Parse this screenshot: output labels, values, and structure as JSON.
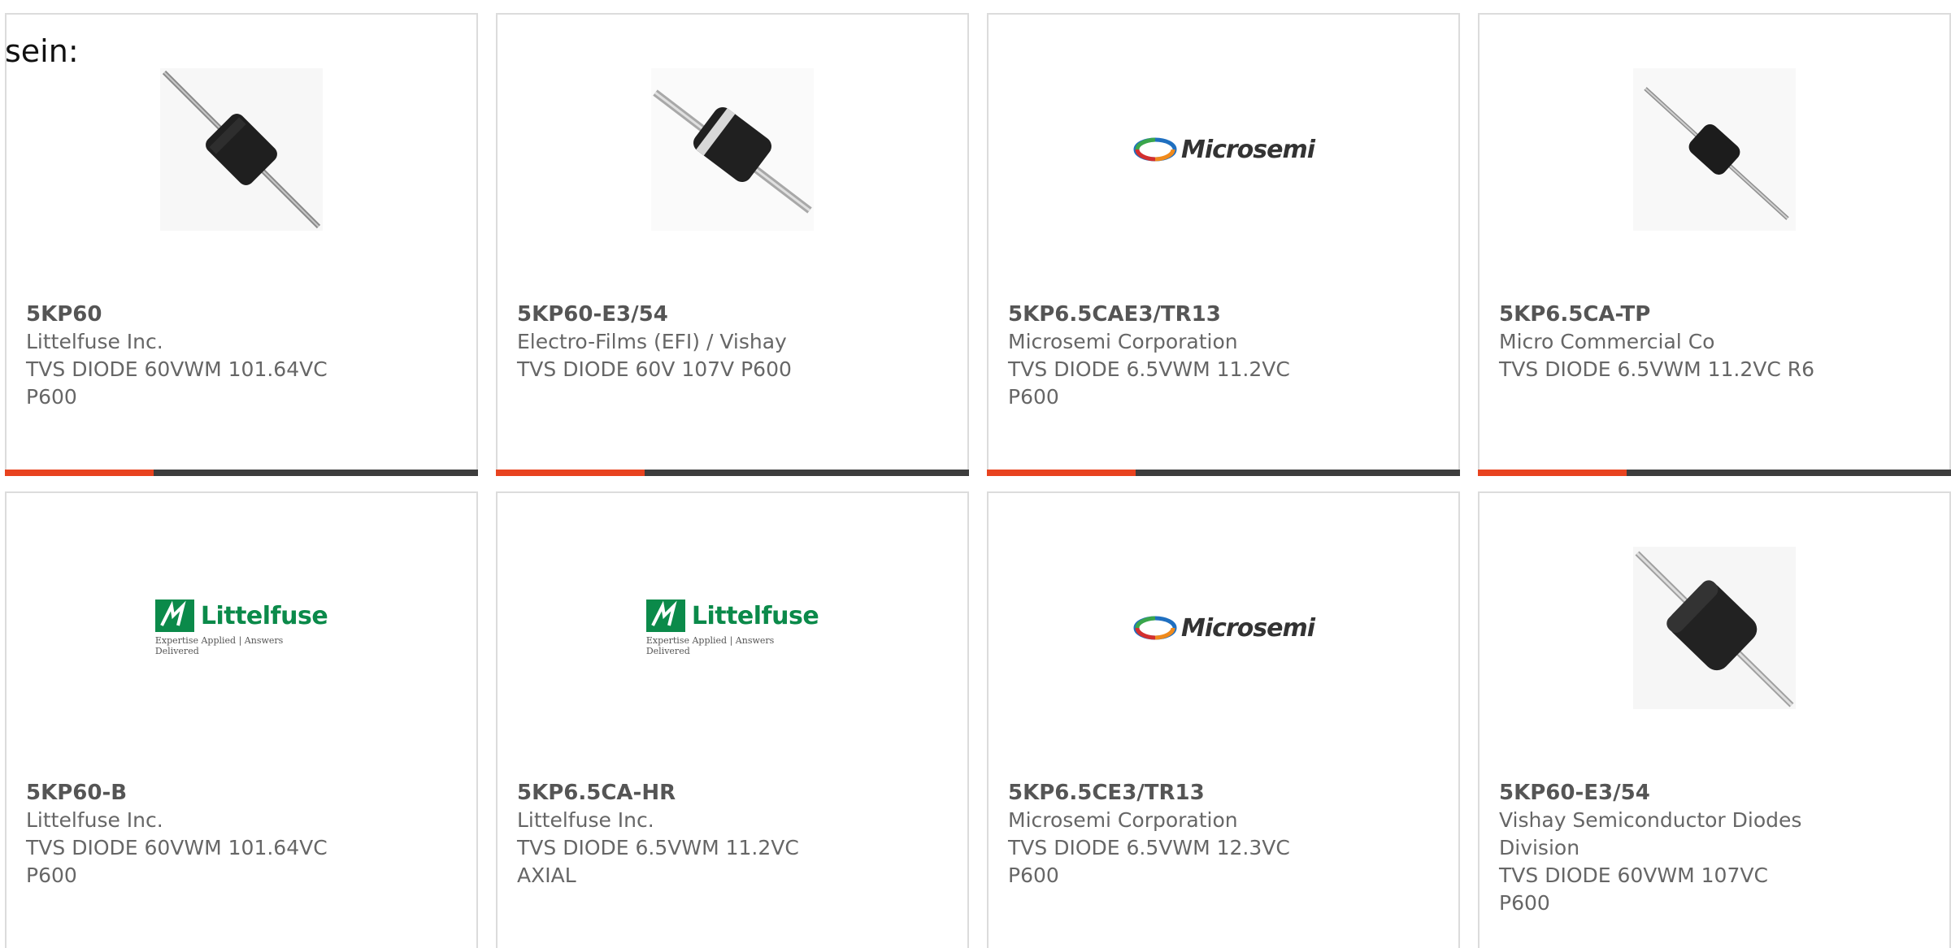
{
  "heading": "sein:",
  "brand_colors": {
    "accent": "#e8431f",
    "bar": "#3d3d3d",
    "littelfuse_green": "#0b8a4a"
  },
  "products": [
    {
      "part": "5KP60",
      "manufacturer": "Littelfuse Inc.",
      "description": "TVS DIODE 60VWM 101.64VC P600",
      "image": "diode-photo-icon",
      "image_alt": "diode photo"
    },
    {
      "part": "5KP60-E3/54",
      "manufacturer": "Electro-Films (EFI) / Vishay",
      "description": "TVS DIODE 60V 107V P600",
      "image": "diode-photo-icon",
      "image_alt": "diode photo"
    },
    {
      "part": "5KP6.5CAE3/TR13",
      "manufacturer": "Microsemi Corporation",
      "description": "TVS DIODE 6.5VWM 11.2VC P600",
      "image": "microsemi-logo",
      "logo_text": "Microsemi"
    },
    {
      "part": "5KP6.5CA-TP",
      "manufacturer": "Micro Commercial Co",
      "description": "TVS DIODE 6.5VWM 11.2VC R6",
      "image": "diode-photo-icon",
      "image_alt": "diode photo"
    },
    {
      "part": "5KP60-B",
      "manufacturer": "Littelfuse Inc.",
      "description": "TVS DIODE 60VWM 101.64VC P600",
      "image": "littelfuse-logo",
      "logo_text": "Littelfuse",
      "logo_tagline": "Expertise Applied | Answers Delivered"
    },
    {
      "part": "5KP6.5CA-HR",
      "manufacturer": "Littelfuse Inc.",
      "description": "TVS DIODE 6.5VWM 11.2VC AXIAL",
      "image": "littelfuse-logo",
      "logo_text": "Littelfuse",
      "logo_tagline": "Expertise Applied | Answers Delivered"
    },
    {
      "part": "5KP6.5CE3/TR13",
      "manufacturer": "Microsemi Corporation",
      "description": "TVS DIODE 6.5VWM 12.3VC P600",
      "image": "microsemi-logo",
      "logo_text": "Microsemi"
    },
    {
      "part": "5KP60-E3/54",
      "manufacturer": "Vishay Semiconductor Diodes Division",
      "description": "TVS DIODE 60VWM 107VC P600",
      "image": "diode-photo-icon",
      "image_alt": "diode photo"
    }
  ]
}
